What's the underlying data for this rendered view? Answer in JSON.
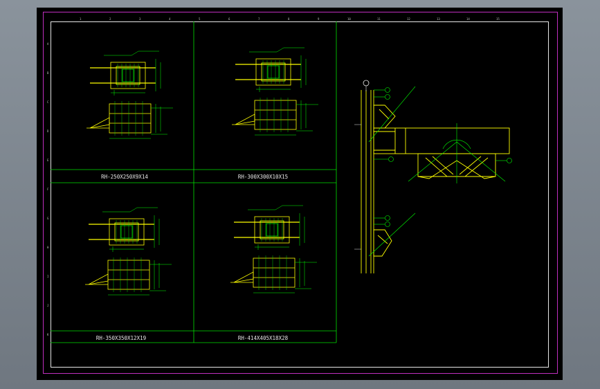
{
  "drawing": {
    "sheet_colors": {
      "background": "#000000",
      "sheet_border": "#c02fc0",
      "frame": "#e8e8e8",
      "grid": "#00e000",
      "steel": "#ffff00",
      "dims": "#00ff00",
      "text": "#e8e8e8"
    },
    "detail_titles": [
      "RH-250X250X9X14",
      "RH-300X300X10X15",
      "RH-350X350X12X19",
      "RH-414X405X18X28"
    ],
    "top_ruler": [
      "1",
      "2",
      "3",
      "4",
      "5",
      "6",
      "7",
      "8",
      "9",
      "10",
      "11",
      "12",
      "13",
      "14",
      "15"
    ],
    "left_ruler": [
      "A",
      "B",
      "C",
      "D",
      "E",
      "F",
      "G",
      "H",
      "I",
      "J",
      "K"
    ],
    "callouts": [
      "①",
      "②",
      "③",
      "④",
      "⑤"
    ]
  }
}
